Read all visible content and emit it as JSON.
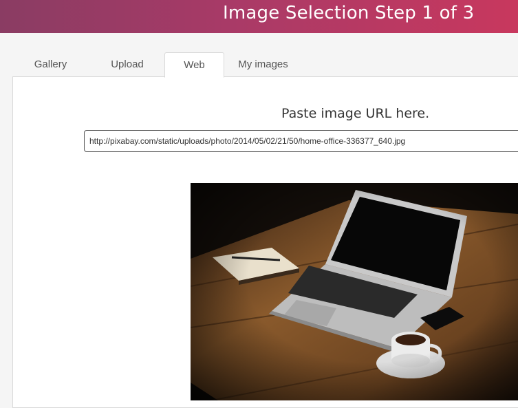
{
  "header": {
    "title": "Image Selection Step 1 of 3"
  },
  "tabs": [
    {
      "label": "Gallery",
      "active": false
    },
    {
      "label": "Upload",
      "active": false
    },
    {
      "label": "Web",
      "active": true
    },
    {
      "label": "My images",
      "active": false
    }
  ],
  "web": {
    "paste_label": "Paste image URL here.",
    "url_value": "http://pixabay.com/static/uploads/photo/2014/05/02/21/50/home-office-336377_640.jpg"
  },
  "colors": {
    "header_start": "#8a3c63",
    "header_end": "#c8385e"
  }
}
